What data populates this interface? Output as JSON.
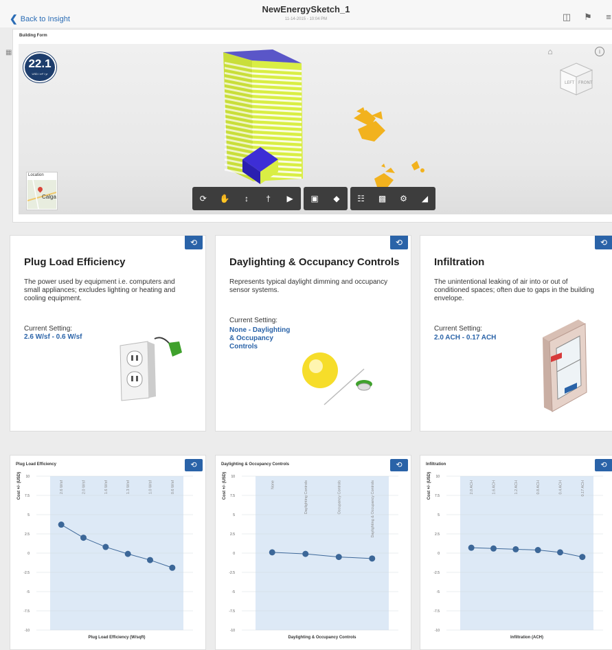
{
  "header": {
    "back_label": "Back to Insight",
    "title": "NewEnergySketch_1",
    "subtitle": "11-14-2015 - 10:04 PM"
  },
  "building_form": {
    "label": "Building Form",
    "eui_value": "22.1",
    "eui_unit": "USD / m² / yr",
    "location_label": "Location",
    "location_city": "Calgar"
  },
  "colors": {
    "accent": "#2a63a8",
    "badge": "#1d3d6c",
    "plot_bg": "#dde9f6",
    "series": "#3c6798",
    "building": "#d9ee44",
    "highlight": "#3d2ed6",
    "shapes": "#f2b21e"
  },
  "toolbar_icons": [
    "orbit-icon",
    "pan-icon",
    "zoom-icon",
    "walk-icon",
    "camera-icon",
    "section-icon",
    "explode-icon",
    "hierarchy-icon",
    "save-icon",
    "settings-icon",
    "fullscreen-icon"
  ],
  "cards": [
    {
      "title": "Plug Load Efficiency",
      "description": "The power used by equipment i.e. computers and small appliances; excludes lighting or heating and cooling equipment.",
      "current_label": "Current Setting:",
      "current_value_lines": [
        "2.6 W/sf - 0.6 W/sf"
      ]
    },
    {
      "title": "Daylighting & Occupancy Controls",
      "description": "Represents typical daylight dimming and occupancy sensor systems.",
      "current_label": "Current Setting:",
      "current_value_lines": [
        "None - Daylighting",
        "& Occupancy",
        "Controls"
      ]
    },
    {
      "title": "Infiltration",
      "description": "The unintentional leaking of air into or out of conditioned spaces; often due to gaps in the building envelope.",
      "current_label": "Current Setting:",
      "current_value_lines": [
        "2.0 ACH - 0.17 ACH"
      ]
    }
  ],
  "chart_data": [
    {
      "type": "line",
      "title": "Plug Load Efficiency",
      "xlabel": "Plug Load Efficiency (W/sqft)",
      "ylabel": "Cost +/- (USD)",
      "categories": [
        "2.6 W/sf",
        "2.0 W/sf",
        "1.6 W/sf",
        "1.3 W/sf",
        "1.0 W/sf",
        "0.6 W/sf"
      ],
      "values": [
        3.7,
        2.0,
        0.8,
        -0.1,
        -0.9,
        -1.9
      ],
      "ylim": [
        -10,
        10
      ],
      "yticks": [
        "10",
        "7.5",
        "5",
        "2.5",
        "0",
        "-2.5",
        "-5",
        "-7.5",
        "-10"
      ]
    },
    {
      "type": "line",
      "title": "Daylighting & Occupancy Controls",
      "xlabel": "Daylighting & Occupancy Controls",
      "ylabel": "Cost +/- (USD)",
      "categories": [
        "None",
        "Daylighting Controls",
        "Occupancy Controls",
        "Daylighting & Occupancy Controls"
      ],
      "values": [
        0.1,
        -0.1,
        -0.5,
        -0.7
      ],
      "ylim": [
        -10,
        10
      ],
      "yticks": [
        "10",
        "7.5",
        "5",
        "2.5",
        "0",
        "-2.5",
        "-5",
        "-7.5",
        "-10"
      ]
    },
    {
      "type": "line",
      "title": "Infiltration",
      "xlabel": "Infiltration (ACH)",
      "ylabel": "Cost +/- (USD)",
      "categories": [
        "2.0 ACH",
        "1.6 ACH",
        "1.2 ACH",
        "0.8 ACH",
        "0.4 ACH",
        "0.17 ACH"
      ],
      "values": [
        0.7,
        0.6,
        0.5,
        0.4,
        0.1,
        -0.5
      ],
      "ylim": [
        -10,
        10
      ],
      "yticks": [
        "10",
        "7.5",
        "5",
        "2.5",
        "0",
        "-2.5",
        "-5",
        "-7.5",
        "-10"
      ]
    }
  ]
}
